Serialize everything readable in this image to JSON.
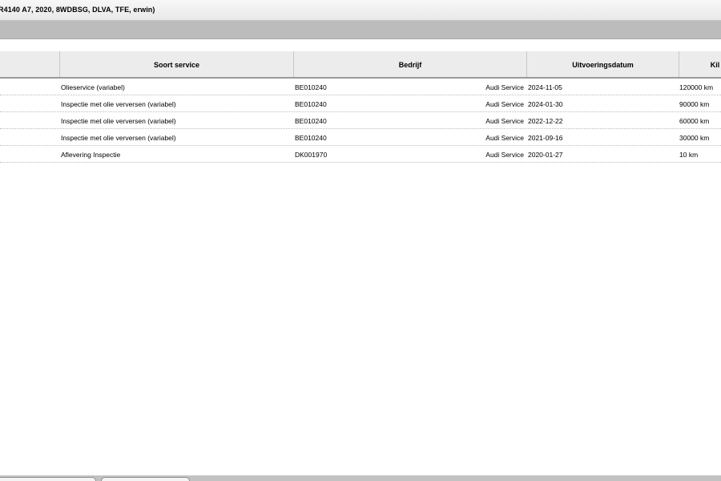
{
  "window": {
    "title": "R4140 A7, 2020, 8WDBSG, DLVA, TFE, erwin)"
  },
  "table": {
    "columns": [
      "",
      "Soort service",
      "Bedrijf",
      "Uitvoeringsdatum",
      "Kil"
    ],
    "rows": [
      {
        "service": "Olieservice (variabel)",
        "code": "BE010240",
        "company": "Audi Service",
        "date": "2024-11-05",
        "km": "120000 km"
      },
      {
        "service": "Inspectie met olie verversen (variabel)",
        "code": "BE010240",
        "company": "Audi Service",
        "date": "2024-01-30",
        "km": "90000 km"
      },
      {
        "service": "Inspectie met olie verversen (variabel)",
        "code": "BE010240",
        "company": "Audi Service",
        "date": "2022-12-22",
        "km": "60000 km"
      },
      {
        "service": "Inspectie met olie verversen (variabel)",
        "code": "BE010240",
        "company": "Audi Service",
        "date": "2021-09-16",
        "km": "30000 km"
      },
      {
        "service": "Aflevering Inspectie",
        "code": "DK001970",
        "company": "Audi Service",
        "date": "2020-01-27",
        "km": "10 km"
      }
    ]
  }
}
